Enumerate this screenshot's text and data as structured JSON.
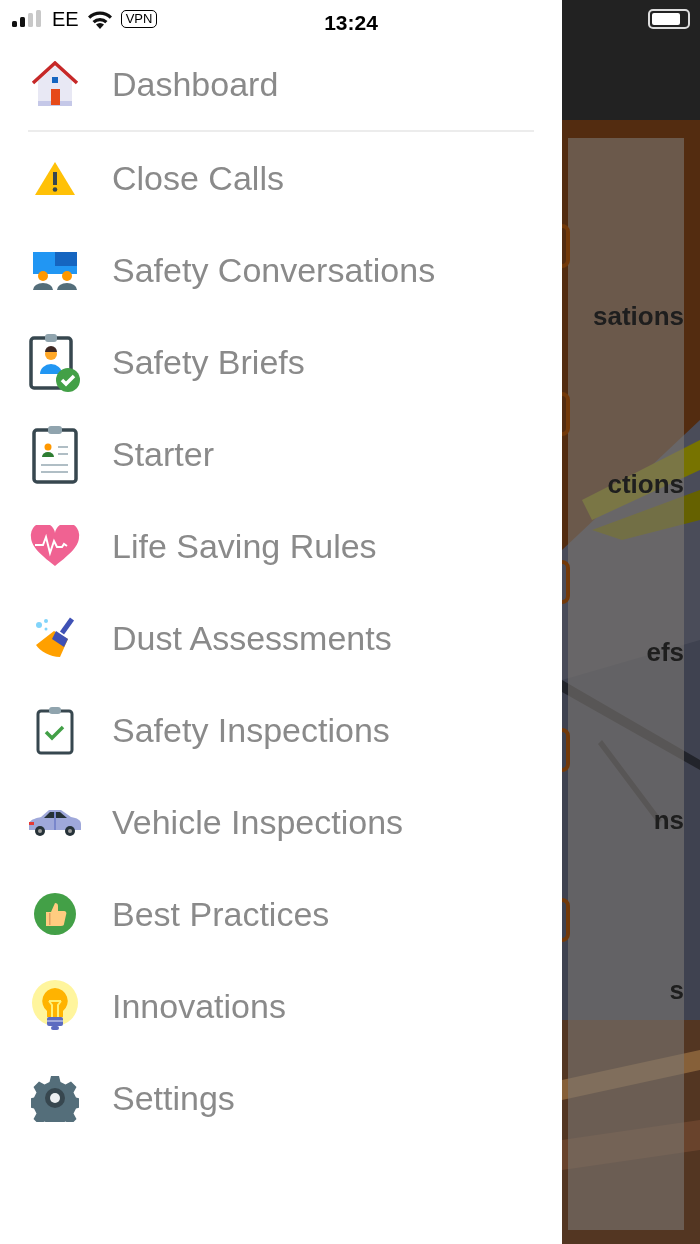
{
  "status_bar": {
    "carrier": "EE",
    "vpn": "VPN",
    "time": "13:24"
  },
  "menu": {
    "items": [
      {
        "label": "Dashboard"
      },
      {
        "label": "Close Calls"
      },
      {
        "label": "Safety Conversations"
      },
      {
        "label": "Safety Briefs"
      },
      {
        "label": "Starter"
      },
      {
        "label": "Life Saving Rules"
      },
      {
        "label": "Dust Assessments"
      },
      {
        "label": "Safety Inspections"
      },
      {
        "label": "Vehicle Inspections"
      },
      {
        "label": "Best Practices"
      },
      {
        "label": "Innovations"
      },
      {
        "label": "Settings"
      }
    ]
  },
  "background": {
    "labels": [
      "sations",
      "ctions",
      "efs",
      "ns",
      "s"
    ]
  }
}
